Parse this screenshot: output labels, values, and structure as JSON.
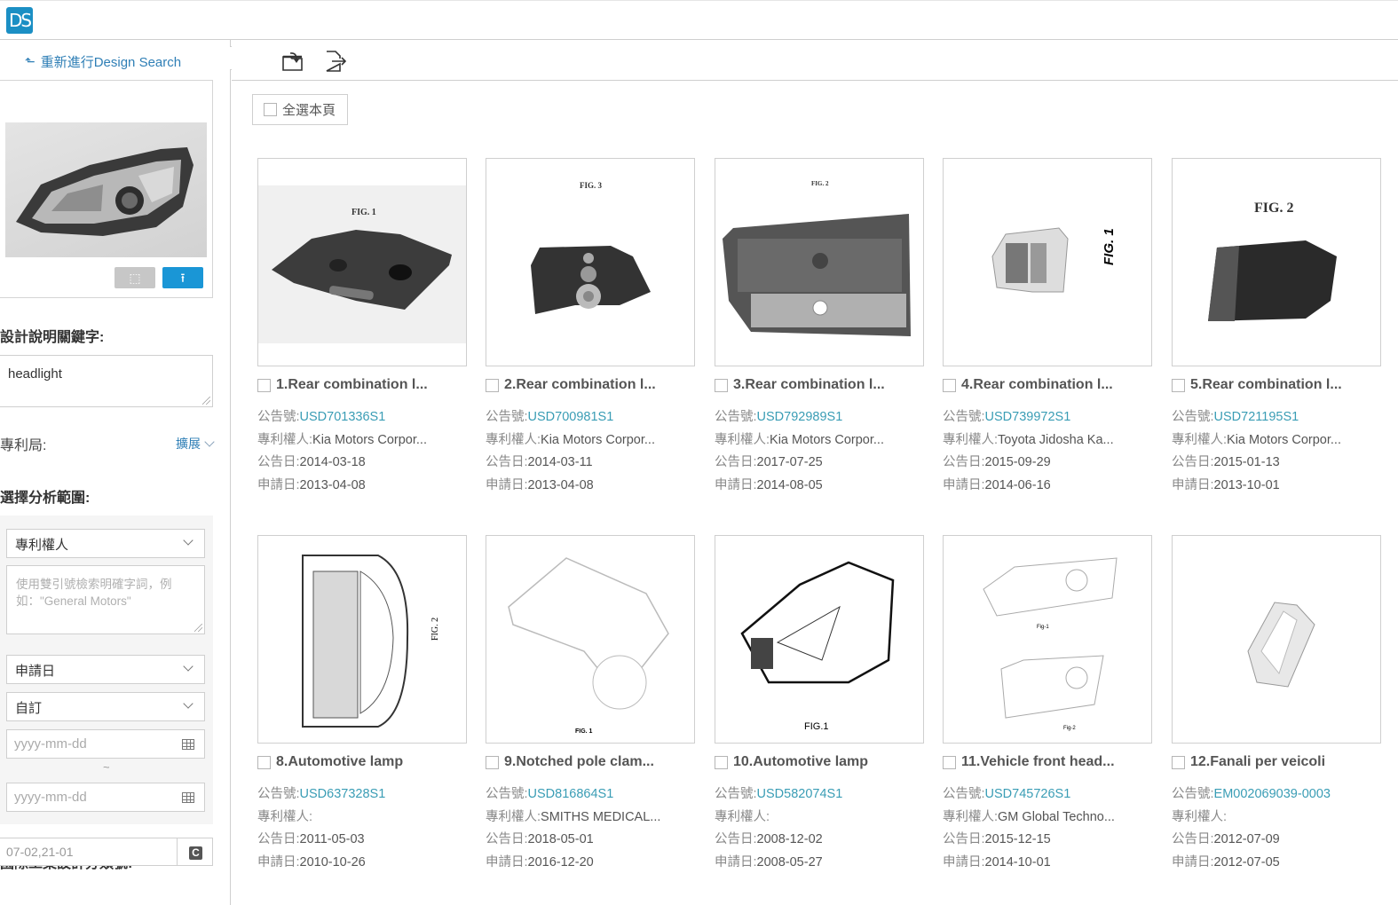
{
  "app": {
    "logo_text": "DS"
  },
  "sidebar": {
    "restart_label": "重新進行Design Search",
    "query_image": {
      "alt": "headlight query image"
    },
    "crop_icon": "crop-icon",
    "upload_icon": "upload-icon",
    "keyword_label": "設計說明關鍵字:",
    "keyword_value": "headlight",
    "office_label": "專利局:",
    "expand_label": "擴展",
    "scope_label": "選擇分析範圍:",
    "field_select": "專利權人",
    "field_placeholder": "使用雙引號檢索明確字詞，例如：\"General Motors\"",
    "date_type_select": "申請日",
    "date_range_select": "自訂",
    "date_from_placeholder": "yyyy-mm-dd",
    "date_separator": "~",
    "date_to_placeholder": "yyyy-mm-dd",
    "class_label": "國際工業設計分類號:",
    "class_value": "07-02,21-01"
  },
  "toolbar": {
    "icons": [
      "folder-import-icon",
      "export-icon"
    ],
    "select_all_label": "全選本頁"
  },
  "labels": {
    "pub_no": "公告號:",
    "assignee": "專利權人:",
    "pub_date": "公告日:",
    "app_date": "申請日:"
  },
  "results": [
    {
      "title": "1.Rear combination l...",
      "pub_no": "USD701336S1",
      "assignee": "Kia Motors Corpor...",
      "pub_date": "2014-03-18",
      "app_date": "2013-04-08",
      "fig": "FIG. 1"
    },
    {
      "title": "2.Rear combination l...",
      "pub_no": "USD700981S1",
      "assignee": "Kia Motors Corpor...",
      "pub_date": "2014-03-11",
      "app_date": "2013-04-08",
      "fig": "FIG. 3"
    },
    {
      "title": "3.Rear combination l...",
      "pub_no": "USD792989S1",
      "assignee": "Kia Motors Corpor...",
      "pub_date": "2017-07-25",
      "app_date": "2014-08-05",
      "fig": "FIG. 2"
    },
    {
      "title": "4.Rear combination l...",
      "pub_no": "USD739972S1",
      "assignee": "Toyota Jidosha Ka...",
      "pub_date": "2015-09-29",
      "app_date": "2014-06-16",
      "fig": "FIG. 1"
    },
    {
      "title": "5.Rear combination l...",
      "pub_no": "USD721195S1",
      "assignee": "Kia Motors Corpor...",
      "pub_date": "2015-01-13",
      "app_date": "2013-10-01",
      "fig": "FIG. 2"
    },
    {
      "title": "8.Automotive lamp",
      "pub_no": "USD637328S1",
      "assignee": "",
      "pub_date": "2011-05-03",
      "app_date": "2010-10-26",
      "fig": "FIG. 2"
    },
    {
      "title": "9.Notched pole clam...",
      "pub_no": "USD816864S1",
      "assignee": "SMITHS MEDICAL...",
      "pub_date": "2018-05-01",
      "app_date": "2016-12-20",
      "fig": "FIG. 1"
    },
    {
      "title": "10.Automotive lamp",
      "pub_no": "USD582074S1",
      "assignee": "",
      "pub_date": "2008-12-02",
      "app_date": "2008-05-27",
      "fig": "FIG.1"
    },
    {
      "title": "11.Vehicle front head...",
      "pub_no": "USD745726S1",
      "assignee": "GM Global Techno...",
      "pub_date": "2015-12-15",
      "app_date": "2014-10-01",
      "fig": "Fig-1 / Fig-2"
    },
    {
      "title": "12.Fanali per veicoli",
      "pub_no": "EM002069039-0003",
      "assignee": "",
      "pub_date": "2012-07-09",
      "app_date": "2012-07-05",
      "fig": ""
    }
  ],
  "colors": {
    "accent": "#1a96d6",
    "link": "#3a9db5",
    "logo": "#1b8fc4"
  }
}
